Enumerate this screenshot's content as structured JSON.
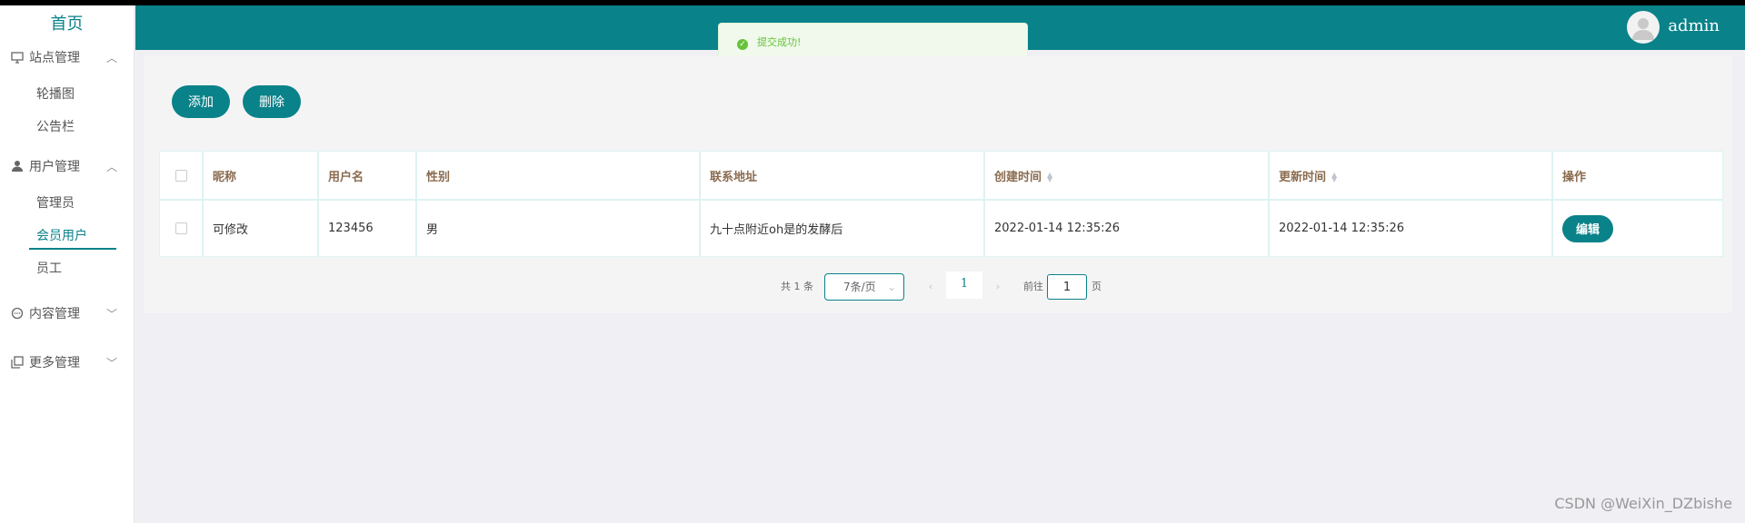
{
  "sidebar": {
    "brand": "首页",
    "groups": [
      {
        "label": "站点管理",
        "items": [
          "轮播图",
          "公告栏"
        ]
      },
      {
        "label": "用户管理",
        "items": [
          "管理员",
          "会员用户",
          "员工"
        ]
      },
      {
        "label": "内容管理"
      },
      {
        "label": "更多管理"
      }
    ]
  },
  "header": {
    "username": "admin"
  },
  "toast": {
    "message": "提交成功!"
  },
  "toolbar": {
    "add_label": "添加",
    "delete_label": "删除"
  },
  "table": {
    "columns": [
      "昵称",
      "用户名",
      "性别",
      "联系地址",
      "创建时间",
      "更新时间",
      "操作"
    ],
    "rows": [
      {
        "nickname": "可修改",
        "username": "123456",
        "gender": "男",
        "address": "九十点附近oh是的发酵后",
        "created": "2022-01-14 12:35:26",
        "updated": "2022-01-14 12:35:26",
        "action": "编辑"
      }
    ]
  },
  "pagination": {
    "total_text": "共 1 条",
    "page_size": "7条/页",
    "current_page": "1",
    "prev_icon": "‹",
    "next_icon": "›",
    "jump_prefix": "前往",
    "jump_value": "1",
    "jump_suffix": "页"
  },
  "watermark": "CSDN @WeiXin_DZbishe",
  "colors": {
    "primary": "#0a8289",
    "success": "#67c23a"
  }
}
